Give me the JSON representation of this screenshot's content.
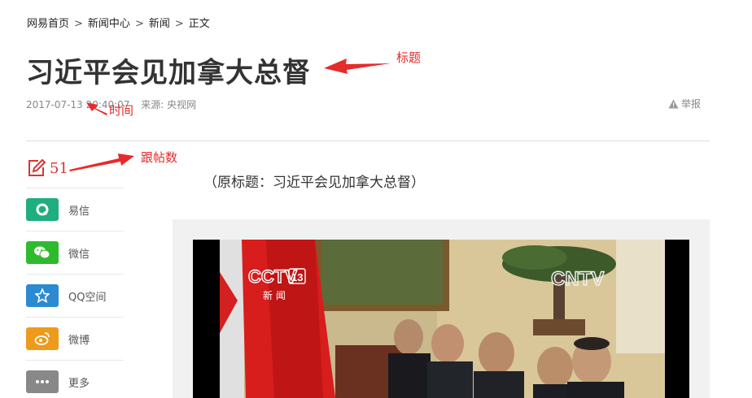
{
  "breadcrumb": {
    "items": [
      "网易首页",
      "新闻中心",
      "新闻",
      "正文"
    ],
    "separator": ">"
  },
  "article": {
    "title": "习近平会见加拿大总督",
    "time": "2017-07-13 20:40:07",
    "source": "来源: 央视网",
    "report_label": "举报",
    "original_title": "（原标题：习近平会见加拿大总督）"
  },
  "comments": {
    "count": "51"
  },
  "share": {
    "items": [
      {
        "label": "易信",
        "color": "#1fae7f",
        "icon": "yixin-icon"
      },
      {
        "label": "微信",
        "color": "#2dbb2d",
        "icon": "wechat-icon"
      },
      {
        "label": "QQ空间",
        "color": "#2b8ad0",
        "icon": "qzone-icon"
      },
      {
        "label": "微博",
        "color": "#ee9a1b",
        "icon": "weibo-icon"
      },
      {
        "label": "更多",
        "color": "#888888",
        "icon": "more-icon"
      }
    ]
  },
  "annotations": {
    "title": "标题",
    "time": "时间",
    "comments": "跟帖数"
  },
  "video": {
    "logo_cctv": "CCTV",
    "logo_channel": "13",
    "logo_news": "新 闻",
    "logo_cntv": "CNTV"
  },
  "colors": {
    "annotation": "#e62b2b",
    "accent": "#d33"
  }
}
